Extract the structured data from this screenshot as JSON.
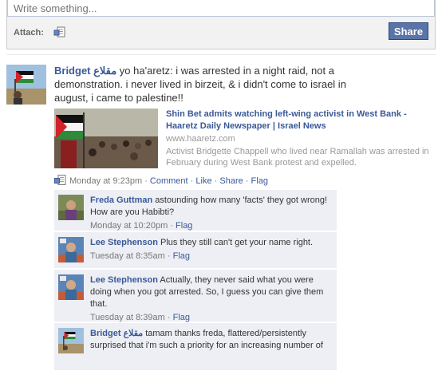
{
  "composer": {
    "placeholder": "Write something...",
    "attach_label": "Attach:",
    "share_label": "Share"
  },
  "story": {
    "actor": "Bridget مقلاع",
    "message": " yo ha'aretz: i was arrested in a night raid, not a demonstration. i never lived in birzeit, & i didn't come to israel in august, i came to palestine!!",
    "attachment": {
      "title": "Shin Bet admits watching left-wing activist in West Bank - Haaretz Daily Newspaper | Israel News",
      "domain": "www.haaretz.com",
      "description": "Activist Bridgette Chappell who lived near Ramallah was arrested in February during West Bank protest and expelled."
    },
    "meta": {
      "time": "Monday at 9:23pm",
      "sep": "·",
      "comment": "Comment",
      "like": "Like",
      "share": "Share",
      "flag": "Flag"
    }
  },
  "comments": [
    {
      "author": "Freda Guttman",
      "text": " astounding how many 'facts' they got wrong! How are you Habibti?",
      "time": "Monday at 10:20pm",
      "flag": "Flag"
    },
    {
      "author": "Lee Stephenson",
      "text": " Plus they still can't get your name right.",
      "time": "Tuesday at 8:35am",
      "flag": "Flag"
    },
    {
      "author": "Lee Stephenson",
      "text": " Actually, they never said what you were doing when you got arrested. So, I guess you can give them that.",
      "time": "Tuesday at 8:39am",
      "flag": "Flag"
    },
    {
      "author": "Bridget مقلاع",
      "text": " tamam thanks freda, flattered/persistently surprised that i'm such a priority for an increasing number of"
    }
  ],
  "colors": {
    "link": "#3b5998",
    "button": "#5b74a8",
    "comment_bg": "#edeff4"
  }
}
